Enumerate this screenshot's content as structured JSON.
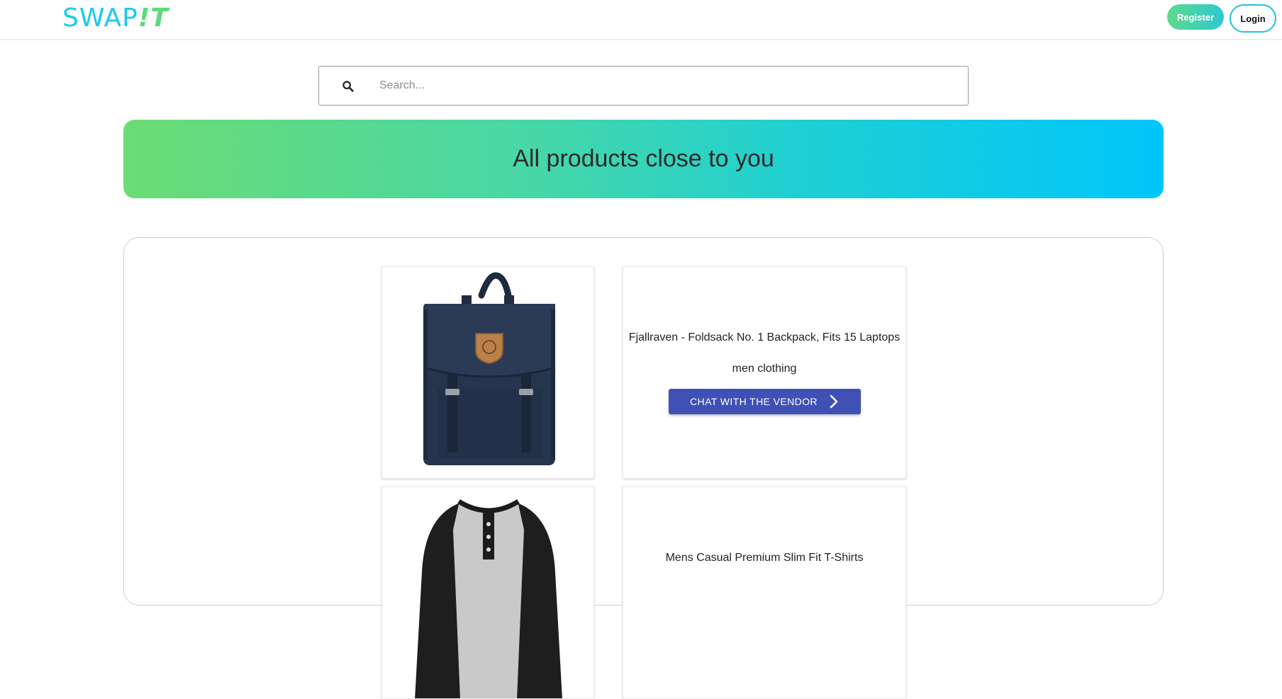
{
  "header": {
    "logo": {
      "part1": "SWAP",
      "part2": "!T"
    },
    "register_label": "Register",
    "login_label": "Login"
  },
  "search": {
    "placeholder": "Search...",
    "value": ""
  },
  "banner": {
    "title": "All products close to you"
  },
  "products": [
    {
      "title": "Fjallraven - Foldsack No. 1 Backpack, Fits 15 Laptops",
      "category": "men clothing",
      "button_label": "CHAT WITH THE VENDOR",
      "image": "navy-backpack"
    },
    {
      "title": "Mens Casual Premium Slim Fit T-Shirts",
      "image": "raglan-tshirt"
    }
  ],
  "colors": {
    "brand_cyan": "#1cc9f0",
    "brand_green": "#5fd97a",
    "button_blue": "#3f51b5",
    "banner_start": "#6cdc74",
    "banner_end": "#00c6fa"
  }
}
